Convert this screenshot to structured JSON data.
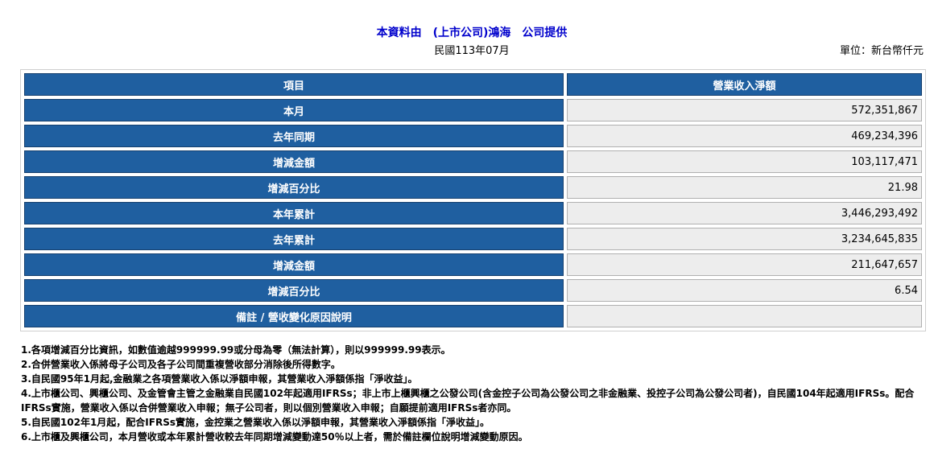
{
  "header": {
    "title": "本資料由　(上市公司)鴻海　公司提供",
    "date": "民國113年07月",
    "unit": "單位：新台幣仟元"
  },
  "table": {
    "columns": [
      "項目",
      "營業收入淨額"
    ],
    "rows": [
      {
        "label": "本月",
        "value": "572,351,867"
      },
      {
        "label": "去年同期",
        "value": "469,234,396"
      },
      {
        "label": "增減金額",
        "value": "103,117,471"
      },
      {
        "label": "增減百分比",
        "value": "21.98"
      },
      {
        "label": "本年累計",
        "value": "3,446,293,492"
      },
      {
        "label": "去年累計",
        "value": "3,234,645,835"
      },
      {
        "label": "增減金額",
        "value": "211,647,657"
      },
      {
        "label": "增減百分比",
        "value": "6.54"
      },
      {
        "label": "備註 / 營收變化原因說明",
        "value": ""
      }
    ]
  },
  "notes": [
    "1.各項增減百分比資訊，如數值逾越999999.99或分母為零（無法計算），則以999999.99表示。",
    "2.合併營業收入係將母子公司及各子公司間重複營收部分消除後所得數字。",
    "3.自民國95年1月起,金融業之各項營業收入係以淨額申報，其營業收入淨額係指「淨收益」。",
    "4.上市櫃公司、興櫃公司、及金管會主管之金融業自民國102年起適用IFRSs；非上市上櫃興櫃之公發公司(含金控子公司為公發公司之非金融業、投控子公司為公發公司者)，自民國104年起適用IFRSs。配合IFRSs實施，營業收入係以合併營業收入申報；無子公司者，則以個別營業收入申報；自願提前適用IFRSs者亦同。",
    "5.自民國102年1月起，配合IFRSs實施，金控業之營業收入係以淨額申報，其營業收入淨額係指「淨收益」。",
    "6.上市櫃及興櫃公司，本月營收或本年累計營收較去年同期增減變動達50％以上者，需於備註欄位說明增減變動原因。"
  ]
}
